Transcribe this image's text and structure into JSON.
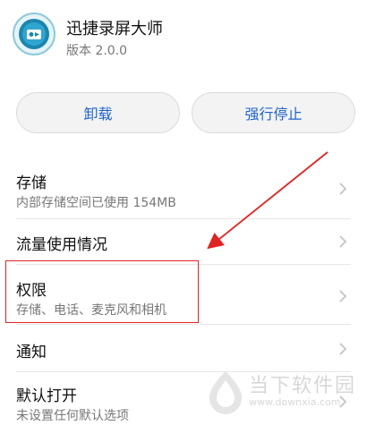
{
  "app": {
    "name": "迅捷录屏大师",
    "version": "版本 2.0.0",
    "icon": "app-icon"
  },
  "buttons": {
    "uninstall": "卸载",
    "force_stop": "强行停止"
  },
  "rows": {
    "storage": {
      "title": "存储",
      "subtitle": "内部存储空间已使用 154MB"
    },
    "data_usage": {
      "title": "流量使用情况"
    },
    "permissions": {
      "title": "权限",
      "subtitle": "存储、电话、麦克风和相机"
    },
    "notifications": {
      "title": "通知"
    },
    "open_by_default": {
      "title": "默认打开",
      "subtitle": "未设置任何默认选项"
    }
  },
  "watermark": {
    "brand": "当下软件园",
    "url": "www.downxia.com"
  },
  "colors": {
    "accent": "#1e64d2",
    "annotation": "#e22222",
    "chevron": "#c8c8c8"
  }
}
